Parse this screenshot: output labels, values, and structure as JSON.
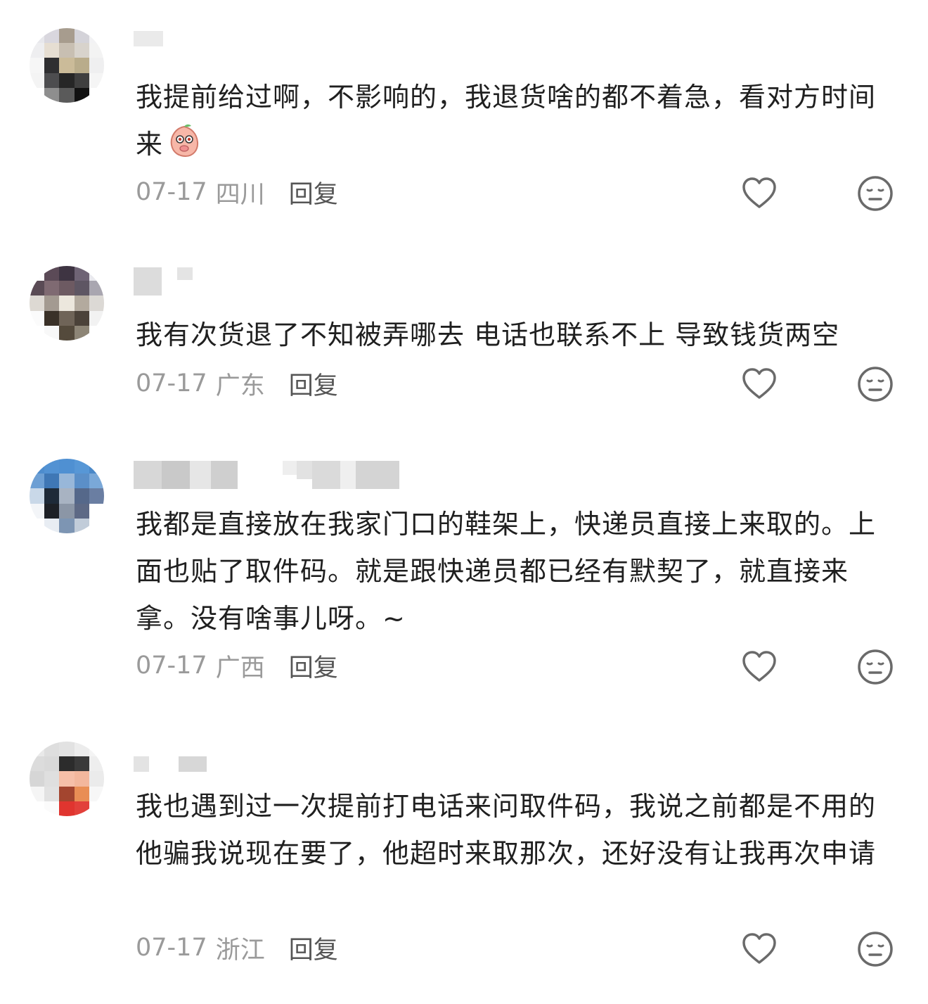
{
  "comments": [
    {
      "text": "我提前给过啊，不影响的，我退货啥的都不着急，看对方时间来",
      "emoji": "peach-face-emoji",
      "date": "07-17",
      "location": "四川",
      "reply_label": "回复"
    },
    {
      "text": "我有次货退了不知被弄哪去 电话也联系不上 导致钱货两空",
      "date": "07-17",
      "location": "广东",
      "reply_label": "回复"
    },
    {
      "text": "我都是直接放在我家门口的鞋架上，快递员直接上来取的。上面也贴了取件码。就是跟快递员都已经有默契了，就直接来拿。没有啥事儿呀。~",
      "date": "07-17",
      "location": "广西",
      "reply_label": "回复"
    },
    {
      "text": "我也遇到过一次提前打电话来问取件码，我说之前都是不用的他骗我说现在要了，他超时来取那次，还好没有让我再次申请",
      "date": "07-17",
      "location": "浙江",
      "reply_label": "回复"
    }
  ],
  "icons": {
    "like": "heart-outline-icon",
    "dislike": "neutral-face-icon"
  },
  "colors": {
    "text": "#1f1f1f",
    "meta": "#9a9a9a",
    "reply": "#555555",
    "icon": "#6a6a6a"
  }
}
